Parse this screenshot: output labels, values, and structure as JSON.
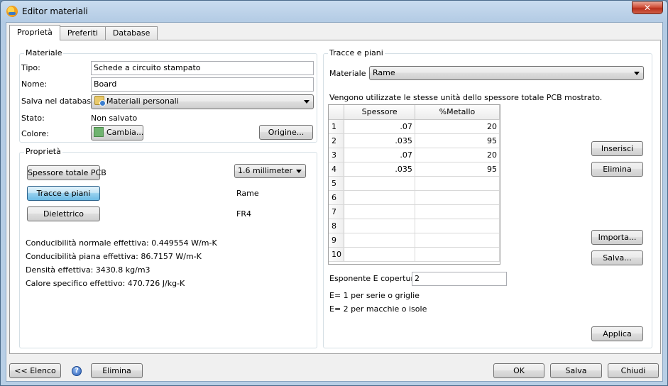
{
  "window": {
    "title": "Editor materiali",
    "close_glyph": "✕"
  },
  "tabs": [
    {
      "label": "Proprietà",
      "active": true
    },
    {
      "label": "Preferiti",
      "active": false
    },
    {
      "label": "Database",
      "active": false
    }
  ],
  "materiale": {
    "group_label": "Materiale",
    "tipo_label": "Tipo:",
    "tipo_value": "Schede a circuito stampato",
    "nome_label": "Nome:",
    "nome_value": "Board",
    "salva_label": "Salva nel database:",
    "salva_value": "Materiali personali",
    "stato_label": "Stato:",
    "stato_value": "Non salvato",
    "colore_label": "Colore:",
    "colore_button": "Cambia...",
    "colore_swatch": "#6fb36f",
    "origine_button": "Origine..."
  },
  "proprieta": {
    "group_label": "Proprietà",
    "spessore_button": "Spessore totale PCB",
    "spessore_value": "1.6 millimeter",
    "tracce_button": "Tracce e piani",
    "tracce_value": "Rame",
    "dielettrico_button": "Dielettrico",
    "dielettrico_value": "FR4",
    "results": [
      "Conducibilità normale effettiva: 0.449554 W/m-K",
      "Conducibilità piana effettiva: 86.7157 W/m-K",
      "Densità effettiva: 3430.8 kg/m3",
      "Calore specifico effettivo: 470.726 J/kg-K"
    ]
  },
  "tracce": {
    "group_label": "Tracce e piani",
    "materiale_label": "Materiale",
    "materiale_value": "Rame",
    "note": "Vengono utilizzate le stesse unità dello spessore totale PCB mostrato.",
    "columns": [
      "Spessore",
      "%Metallo"
    ],
    "rows": [
      {
        "n": "1",
        "spessore": ".07",
        "metallo": "20"
      },
      {
        "n": "2",
        "spessore": ".035",
        "metallo": "95"
      },
      {
        "n": "3",
        "spessore": ".07",
        "metallo": "20"
      },
      {
        "n": "4",
        "spessore": ".035",
        "metallo": "95"
      },
      {
        "n": "5",
        "spessore": "",
        "metallo": ""
      },
      {
        "n": "6",
        "spessore": "",
        "metallo": ""
      },
      {
        "n": "7",
        "spessore": "",
        "metallo": ""
      },
      {
        "n": "8",
        "spessore": "",
        "metallo": ""
      },
      {
        "n": "9",
        "spessore": "",
        "metallo": ""
      },
      {
        "n": "10",
        "spessore": "",
        "metallo": ""
      }
    ],
    "inserisci_button": "Inserisci",
    "elimina_button": "Elimina",
    "importa_button": "Importa...",
    "salva_button": "Salva...",
    "esponente_label": "Esponente E copertura",
    "esponente_value": "2",
    "hint1": "E= 1 per serie o griglie",
    "hint2": "E= 2 per macchie o isole",
    "applica_button": "Applica"
  },
  "footer": {
    "elenco_button": "<< Elenco",
    "help_glyph": "?",
    "elimina_button": "Elimina",
    "ok_button": "OK",
    "salva_button": "Salva",
    "chiudi_button": "Chiudi"
  }
}
